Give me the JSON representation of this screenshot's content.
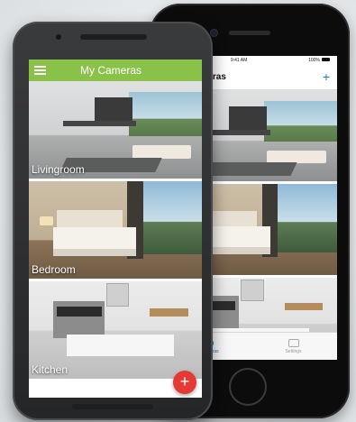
{
  "android": {
    "app_title": "My Cameras",
    "cameras": [
      {
        "label": "Livingroom"
      },
      {
        "label": "Bedroom"
      },
      {
        "label": "Kitchen"
      }
    ],
    "fab_symbol": "+",
    "colors": {
      "appbar": "#8ac249",
      "fab": "#e53935"
    }
  },
  "iphone": {
    "status": {
      "time": "9:41 AM",
      "battery": "100%"
    },
    "nav_title": "My Cameras",
    "add_symbol": "+",
    "tabs": [
      {
        "label": "My Cameras",
        "icon": "cloud-icon",
        "active": true
      },
      {
        "label": "Settings",
        "icon": "settings-icon",
        "active": false
      }
    ],
    "colors": {
      "accent": "#1a7be0"
    }
  }
}
